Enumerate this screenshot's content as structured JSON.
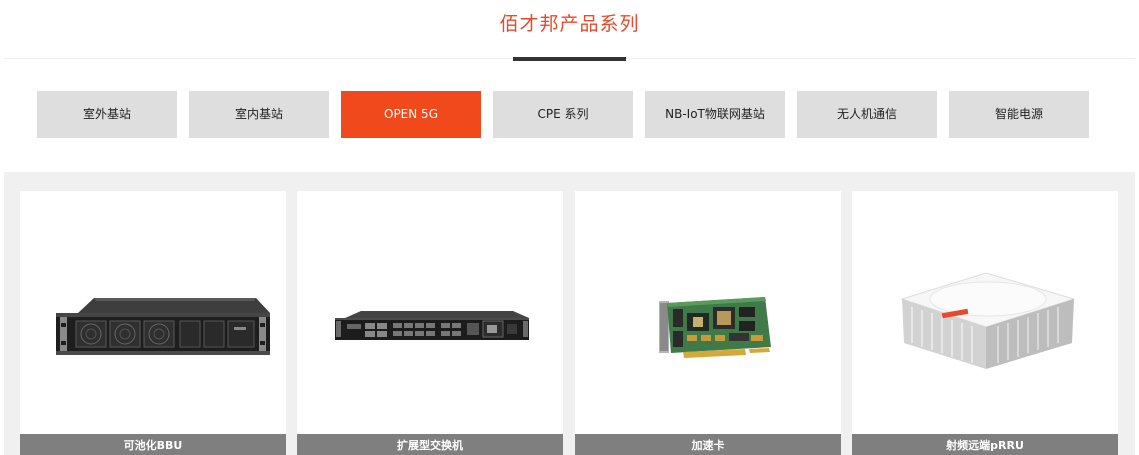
{
  "section": {
    "title": "佰才邦产品系列"
  },
  "tabs": [
    {
      "label": "室外基站",
      "active": false
    },
    {
      "label": "室内基站",
      "active": false
    },
    {
      "label": "OPEN 5G",
      "active": true
    },
    {
      "label": "CPE 系列",
      "active": false
    },
    {
      "label": "NB-IoT物联网基站",
      "active": false
    },
    {
      "label": "无人机通信",
      "active": false
    },
    {
      "label": "智能电源",
      "active": false
    }
  ],
  "products": [
    {
      "name": "可池化BBU",
      "image": "rack-server-2u-image"
    },
    {
      "name": "扩展型交换机",
      "image": "rack-switch-1u-image"
    },
    {
      "name": "加速卡",
      "image": "pcie-accelerator-card-image"
    },
    {
      "name": "射频远端pRRU",
      "image": "indoor-radio-unit-image"
    }
  ],
  "colors": {
    "accent": "#f04a1c",
    "title": "#e8492a",
    "tab_bg": "#dedede",
    "caption_bg": "#7f7f7f",
    "grid_bg": "#f0f0f0"
  }
}
